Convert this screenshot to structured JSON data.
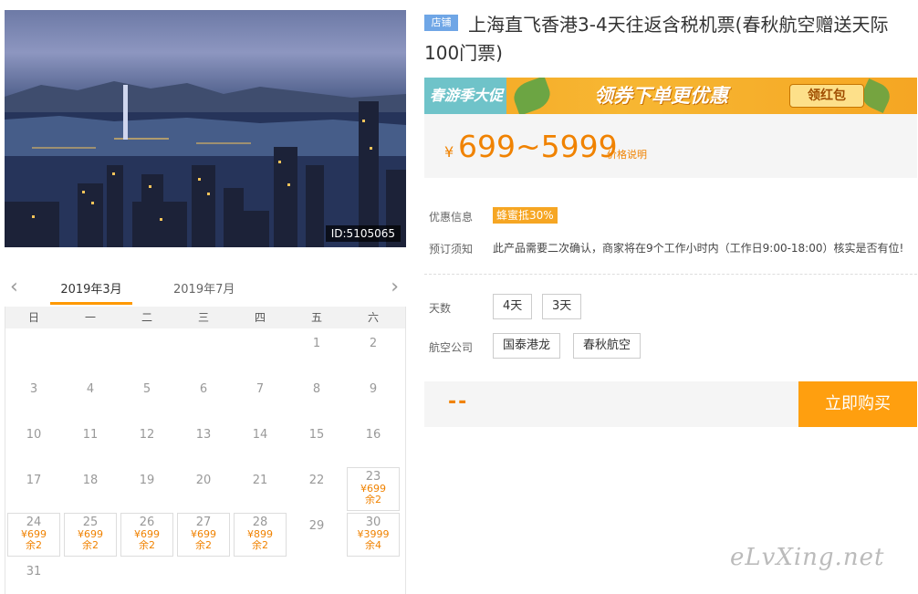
{
  "photo": {
    "id_label": "ID:5105065"
  },
  "calendar": {
    "prev_arrow": "‹",
    "next_arrow": "›",
    "months": [
      "2019年3月",
      "2019年7月"
    ],
    "weekdays": [
      "日",
      "一",
      "二",
      "三",
      "四",
      "五",
      "六"
    ],
    "days": [
      {
        "d": "1"
      },
      {
        "d": "2"
      },
      {
        "d": "3"
      },
      {
        "d": "4"
      },
      {
        "d": "5"
      },
      {
        "d": "6"
      },
      {
        "d": "7"
      },
      {
        "d": "8"
      },
      {
        "d": "9"
      },
      {
        "d": "10"
      },
      {
        "d": "11"
      },
      {
        "d": "12"
      },
      {
        "d": "13"
      },
      {
        "d": "14"
      },
      {
        "d": "15"
      },
      {
        "d": "16"
      },
      {
        "d": "17"
      },
      {
        "d": "18"
      },
      {
        "d": "19"
      },
      {
        "d": "20"
      },
      {
        "d": "21"
      },
      {
        "d": "22"
      },
      {
        "d": "23",
        "price": "¥699",
        "stock": "余2"
      },
      {
        "d": "24",
        "price": "¥699",
        "stock": "余2"
      },
      {
        "d": "25",
        "price": "¥699",
        "stock": "余2"
      },
      {
        "d": "26",
        "price": "¥699",
        "stock": "余2"
      },
      {
        "d": "27",
        "price": "¥699",
        "stock": "余2"
      },
      {
        "d": "28",
        "price": "¥899",
        "stock": "余2"
      },
      {
        "d": "29"
      },
      {
        "d": "30",
        "price": "¥3999",
        "stock": "余4"
      },
      {
        "d": "31"
      }
    ]
  },
  "product": {
    "shop_badge": "店铺",
    "title": "上海直飞香港3-4天往返含税机票(春秋航空赠送天际100门票)"
  },
  "promo": {
    "left_text": "春游季大促",
    "main_text": "领券下单更优惠",
    "button": "领红包"
  },
  "price": {
    "currency": "¥",
    "range": "699~5999",
    "note": "价格说明"
  },
  "info": {
    "discount_label": "优惠信息",
    "discount_tag": "蜂蜜抵30%",
    "notice_label": "预订须知",
    "notice_text": "此产品需要二次确认，商家将在9个工作小时内（工作日9:00-18:00）核实是否有位!"
  },
  "options": {
    "days_label": "天数",
    "days": [
      "4天",
      "3天"
    ],
    "airline_label": "航空公司",
    "airlines": [
      "国泰港龙",
      "春秋航空"
    ]
  },
  "buy": {
    "total": "--",
    "button": "立即购买"
  },
  "watermark": "eLvXing.net"
}
